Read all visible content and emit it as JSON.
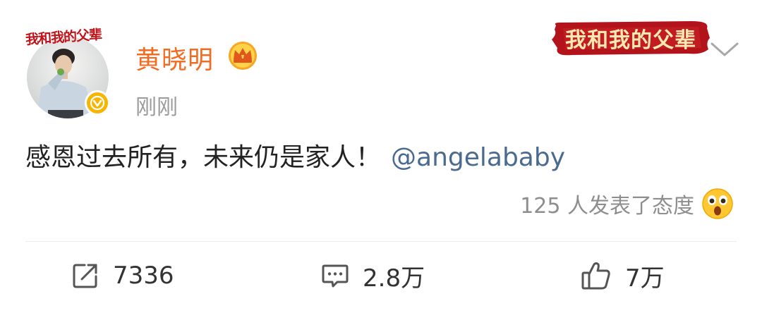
{
  "post": {
    "avatar_badge_text": "我和我的父辈",
    "username": "黄晓明",
    "timestamp": "刚刚",
    "promo_banner_text": "我和我的父辈",
    "body_text": "感恩过去所有，未来仍是家人！",
    "mention": "@angelababy",
    "reactions_text": "125 人发表了态度",
    "reaction_emoji": "surprised-face-icon"
  },
  "actions": {
    "repost_count": "7336",
    "comment_count": "2.8万",
    "like_count": "7万"
  },
  "colors": {
    "username": "#f26b21",
    "mention": "#4a6b8f",
    "badge": "#f7b500",
    "banner_red": "#b3141b"
  }
}
